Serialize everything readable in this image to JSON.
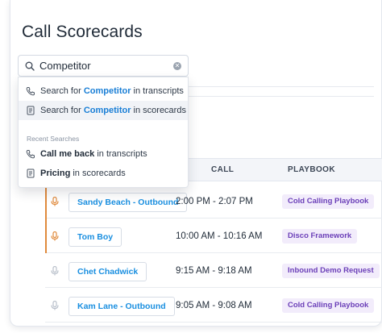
{
  "page": {
    "title": "Call Scorecards"
  },
  "search": {
    "value": "Competitor",
    "suggestions": [
      {
        "prefix": "Search for ",
        "keyword": "Competitor",
        "suffix": " in transcripts",
        "icon": "transcript-icon"
      },
      {
        "prefix": "Search for ",
        "keyword": "Competitor",
        "suffix": " in scorecards",
        "icon": "scorecard-icon"
      }
    ],
    "recent_label": "Recent Searches",
    "recent": [
      {
        "keyword": "Call me back",
        "suffix": " in transcripts",
        "icon": "transcript-icon"
      },
      {
        "keyword": "Pricing",
        "suffix": " in scorecards",
        "icon": "scorecard-icon"
      }
    ]
  },
  "table": {
    "headers": {
      "call": "CALL",
      "playbook": "PLAYBOOK"
    },
    "rows": [
      {
        "name": "Sandy Beach - Outbound",
        "time": "2:00 PM - 2:07 PM",
        "playbook": "Cold Calling Playbook",
        "active": true
      },
      {
        "name": "Tom Boy",
        "time": "10:00 AM - 10:16 AM",
        "playbook": "Disco Framework",
        "active": true
      },
      {
        "name": "Chet Chadwick",
        "time": "9:15 AM - 9:18 AM",
        "playbook": "Inbound Demo Request",
        "active": false
      },
      {
        "name": "Kam Lane - Outbound",
        "time": "9:05 AM - 9:08 AM",
        "playbook": "Cold Calling Playbook",
        "active": false
      }
    ]
  },
  "colors": {
    "link": "#1a7fd6",
    "accent_orange": "#e08a3c",
    "badge_bg": "#f2ecfb",
    "badge_text": "#6b3fb8"
  }
}
